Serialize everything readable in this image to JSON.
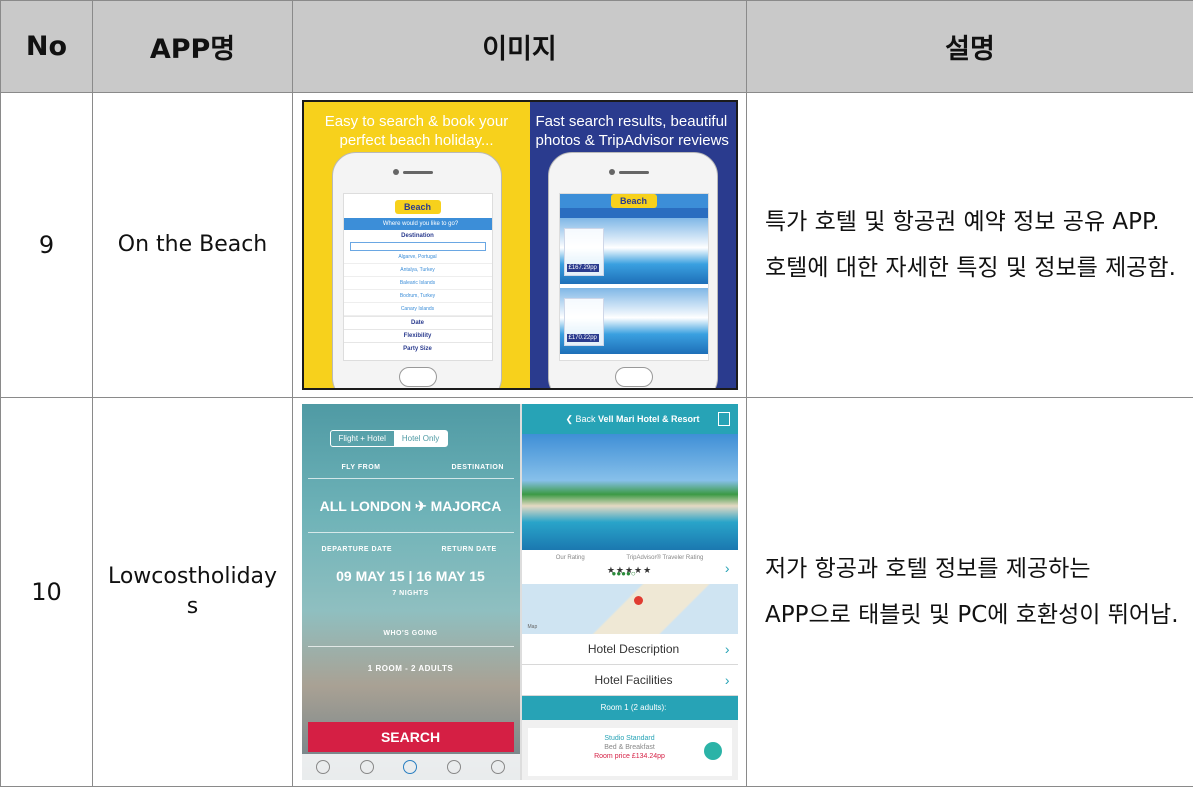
{
  "header": {
    "col_no": "No",
    "col_app": "APP명",
    "col_image": "이미지",
    "col_desc": "설명"
  },
  "rows": [
    {
      "no": "9",
      "app_name": "On the Beach",
      "description": "특가 호텔 및 항공권 예약 정보 공유 APP. 호텔에 대한 자세한 특징 및 정보를 제공함.",
      "screenshot": {
        "panel_left_caption": "Easy to search & book your perfect beach holiday...",
        "panel_right_caption": "Fast search results, beautiful photos & TripAdvisor reviews",
        "logo": "Beach",
        "where_prompt": "Where would you like to go?",
        "destination_label": "Destination",
        "places": [
          "Algarve, Portugal",
          "Antalya, Turkey",
          "Balearic Islands",
          "Bodrum, Turkey",
          "Canary Islands"
        ],
        "option_date": "Date",
        "option_flexibility": "Flexibility",
        "option_party": "Party Size",
        "price_1": "£167.29pp",
        "price_2": "£170.22pp",
        "colors": {
          "yellow": "#f7d11c",
          "navy": "#2a3b8e"
        }
      }
    },
    {
      "no": "10",
      "app_name": "Lowcostholidays",
      "description": "저가 항공과 호텔 정보를 제공하는 APP으로 태블릿 및 PC에 호환성이 뛰어남.",
      "screenshot": {
        "toggle_left": "Flight + Hotel",
        "toggle_right": "Hotel Only",
        "fly_from_label": "FLY FROM",
        "destination_label": "DESTINATION",
        "from_value": "ALL LONDON",
        "to_value": "MAJORCA",
        "departure_label": "DEPARTURE DATE",
        "return_label": "RETURN DATE",
        "departure_value": "09 MAY 15",
        "return_value": "16 MAY 15",
        "nights": "7 NIGHTS",
        "who_label": "WHO'S GOING",
        "rooms": "1 ROOM - 2 ADULTS",
        "search_button": "SEARCH",
        "back": "Back",
        "hotel_title": "Vell Mari Hotel & Resort",
        "rating_label": "Our Rating",
        "tripadvisor_label": "TripAdvisor® Traveler Rating",
        "stars": "★★★★★",
        "ta_dots": "●●●●○",
        "map_label": "Map",
        "row_description": "Hotel Description",
        "row_facilities": "Hotel Facilities",
        "room_header": "Room 1 (2 adults):",
        "room_type": "Studio Standard",
        "board": "Bed & Breakfast",
        "room_price": "Room price £134.24pp",
        "colors": {
          "teal": "#27a3b6",
          "red": "#d51f44"
        }
      }
    }
  ]
}
